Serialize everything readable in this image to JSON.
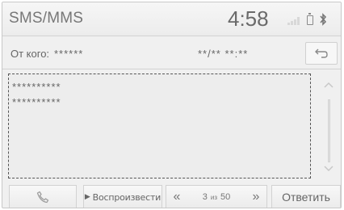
{
  "header": {
    "app_title": "SMS/MMS",
    "clock": "4:58",
    "status_icons": [
      "signal-icon",
      "battery-icon",
      "bluetooth-icon"
    ],
    "bluetooth_glyph": "ʙ"
  },
  "message": {
    "from_label": "От кого:",
    "from_value": "******",
    "datetime": "**/** **:**",
    "body": "**********\n**********"
  },
  "toolbar": {
    "play_label": "Воспроизвести",
    "page_current": "3",
    "page_of": "из",
    "page_total": "50",
    "reply_label": "Ответить"
  }
}
